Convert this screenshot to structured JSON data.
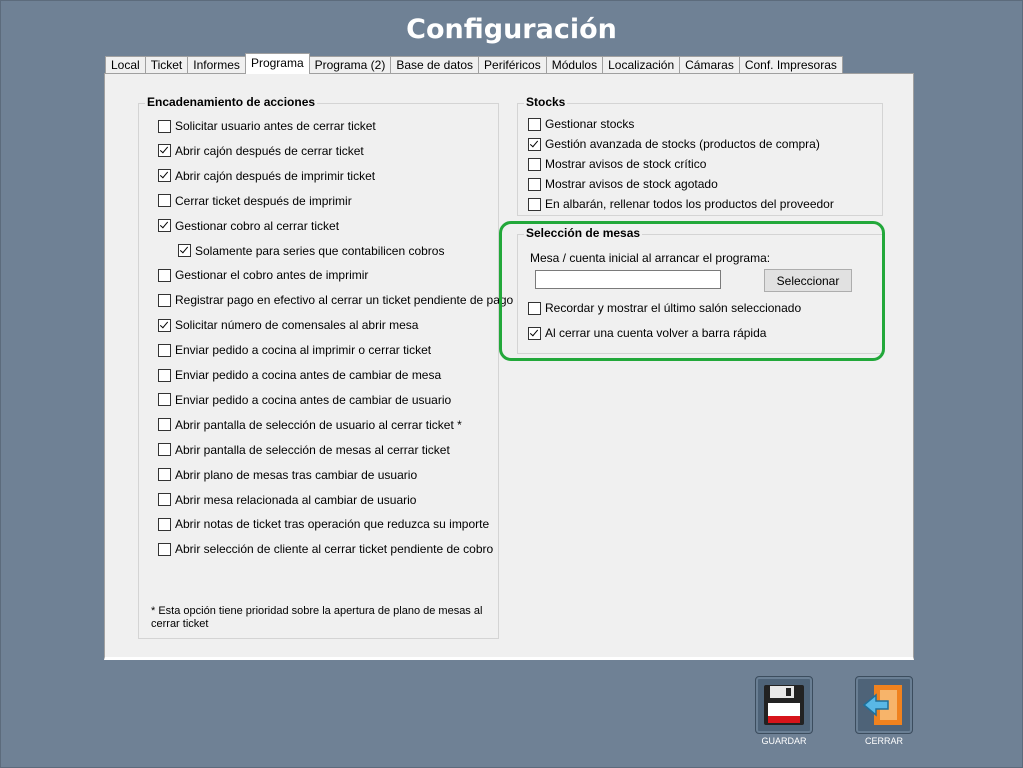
{
  "window": {
    "title": "Configuración"
  },
  "tabs": [
    {
      "label": "Local"
    },
    {
      "label": "Ticket"
    },
    {
      "label": "Informes"
    },
    {
      "label": "Programa",
      "active": true
    },
    {
      "label": "Programa (2)"
    },
    {
      "label": "Base de datos"
    },
    {
      "label": "Periféricos"
    },
    {
      "label": "Módulos"
    },
    {
      "label": "Localización"
    },
    {
      "label": "Cámaras"
    },
    {
      "label": "Conf. Impresoras"
    }
  ],
  "encadenamiento": {
    "title": "Encadenamiento de acciones",
    "items": [
      {
        "label": "Solicitar usuario antes de cerrar ticket",
        "checked": false
      },
      {
        "label": "Abrir cajón después de cerrar ticket",
        "checked": true
      },
      {
        "label": "Abrir cajón después de imprimir ticket",
        "checked": true
      },
      {
        "label": "Cerrar ticket después de imprimir",
        "checked": false
      },
      {
        "label": "Gestionar cobro al cerrar ticket",
        "checked": true
      },
      {
        "label": "Solamente para series que contabilicen cobros",
        "checked": true,
        "indent": true
      },
      {
        "label": "Gestionar el cobro antes de imprimir",
        "checked": false
      },
      {
        "label": "Registrar pago en efectivo al cerrar un ticket pendiente de pago",
        "checked": false
      },
      {
        "label": "Solicitar número de comensales al abrir mesa",
        "checked": true
      },
      {
        "label": "Enviar pedido a cocina al imprimir o cerrar ticket",
        "checked": false
      },
      {
        "label": "Enviar pedido a cocina antes de cambiar de mesa",
        "checked": false
      },
      {
        "label": "Enviar pedido a cocina antes de cambiar de usuario",
        "checked": false
      },
      {
        "label": "Abrir pantalla de selección de usuario al cerrar ticket *",
        "checked": false
      },
      {
        "label": "Abrir pantalla de selección de mesas al cerrar ticket",
        "checked": false
      },
      {
        "label": "Abrir plano de mesas tras cambiar de usuario",
        "checked": false
      },
      {
        "label": "Abrir mesa relacionada al cambiar de usuario",
        "checked": false
      },
      {
        "label": "Abrir notas de ticket tras operación que reduzca su importe",
        "checked": false
      },
      {
        "label": "Abrir selección de cliente al cerrar ticket pendiente de cobro",
        "checked": false
      }
    ],
    "note": "* Esta opción tiene prioridad sobre la apertura de plano de mesas al cerrar ticket"
  },
  "stocks": {
    "title": "Stocks",
    "items": [
      {
        "label": "Gestionar stocks",
        "checked": false
      },
      {
        "label": "Gestión avanzada de stocks (productos de compra)",
        "checked": true
      },
      {
        "label": "Mostrar avisos de stock crítico",
        "checked": false
      },
      {
        "label": "Mostrar avisos de stock agotado",
        "checked": false
      },
      {
        "label": "En albarán, rellenar todos los productos del proveedor",
        "checked": false
      }
    ]
  },
  "mesas": {
    "title": "Selección de mesas",
    "input_label": "Mesa / cuenta inicial al arrancar el programa:",
    "input_value": "",
    "select_button": "Seleccionar",
    "items": [
      {
        "label": "Recordar y mostrar el último salón seleccionado",
        "checked": false
      },
      {
        "label": "Al cerrar una cuenta volver a barra rápida",
        "checked": true
      }
    ]
  },
  "actions": {
    "save_label": "GUARDAR",
    "close_label": "CERRAR"
  },
  "colors": {
    "background": "#6f8195",
    "highlight": "#22a83a",
    "save_red": "#d7141a",
    "close_orange": "#f0821e"
  }
}
